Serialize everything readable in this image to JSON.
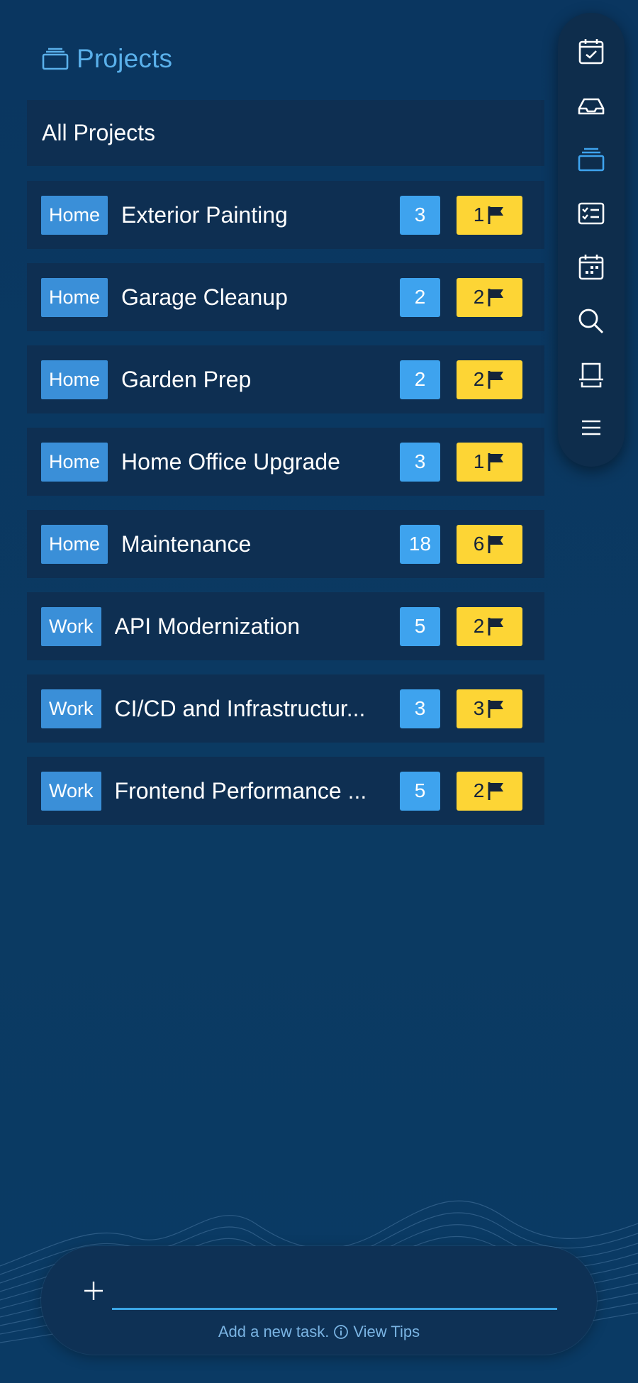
{
  "header": {
    "title": "Projects",
    "icon": "projects-stack-icon"
  },
  "all_projects_label": "All Projects",
  "projects": [
    {
      "tag": "Home",
      "name": "Exterior Painting",
      "count": "3",
      "flags": "1"
    },
    {
      "tag": "Home",
      "name": "Garage Cleanup",
      "count": "2",
      "flags": "2"
    },
    {
      "tag": "Home",
      "name": "Garden Prep",
      "count": "2",
      "flags": "2"
    },
    {
      "tag": "Home",
      "name": "Home Office Upgrade",
      "count": "3",
      "flags": "1"
    },
    {
      "tag": "Home",
      "name": "Maintenance",
      "count": "18",
      "flags": "6"
    },
    {
      "tag": "Work",
      "name": "API Modernization",
      "count": "5",
      "flags": "2"
    },
    {
      "tag": "Work",
      "name": "CI/CD and Infrastructur...",
      "count": "3",
      "flags": "3"
    },
    {
      "tag": "Work",
      "name": "Frontend Performance ...",
      "count": "5",
      "flags": "2"
    }
  ],
  "rail": {
    "items": [
      "calendar-check-icon",
      "inbox-icon",
      "projects-stack-icon",
      "checklist-icon",
      "calendar-grid-icon",
      "search-icon",
      "archive-icon",
      "menu-icon"
    ],
    "active": "projects-stack-icon"
  },
  "input": {
    "placeholder": "",
    "hint": "Add a new task.",
    "tips_label": "View Tips"
  },
  "colors": {
    "background": "#0b3961",
    "card": "#0e2f52",
    "tag": "#3a8fd8",
    "count": "#3ea3ee",
    "flag_badge": "#fdd535",
    "accent": "#5ab0ea"
  }
}
